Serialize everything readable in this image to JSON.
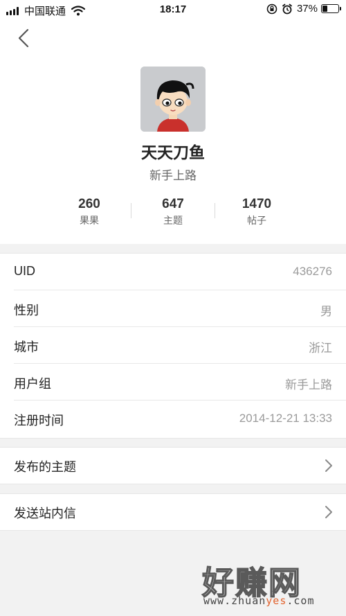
{
  "status_bar": {
    "carrier": "中国联通",
    "time": "18:17",
    "battery_percent": "37%",
    "battery_level": 0.37
  },
  "profile": {
    "back_icon": "chevron-left-icon",
    "avatar_icon": "cartoon-boy-avatar",
    "name": "天天刀鱼",
    "rank": "新手上路",
    "stats": [
      {
        "value": "260",
        "label": "果果"
      },
      {
        "value": "647",
        "label": "主题"
      },
      {
        "value": "1470",
        "label": "帖子"
      }
    ]
  },
  "info": [
    {
      "key": "UID",
      "value": "436276"
    },
    {
      "key": "性别",
      "value": "男"
    },
    {
      "key": "城市",
      "value": "浙江"
    },
    {
      "key": "用户组",
      "value": "新手上路"
    },
    {
      "key": "注册时间",
      "value": "2014-12-21 13:33"
    }
  ],
  "actions": {
    "published_topics": "发布的主题",
    "send_message": "发送站内信"
  },
  "watermark": {
    "title": "好赚网",
    "url_prefix": "www.zhuan",
    "url_highlight": "yes",
    "url_suffix": ".com"
  },
  "colors": {
    "background": "#f2f2f2",
    "value_gray": "#9a9a9a",
    "watermark_accent": "#e2632e"
  }
}
